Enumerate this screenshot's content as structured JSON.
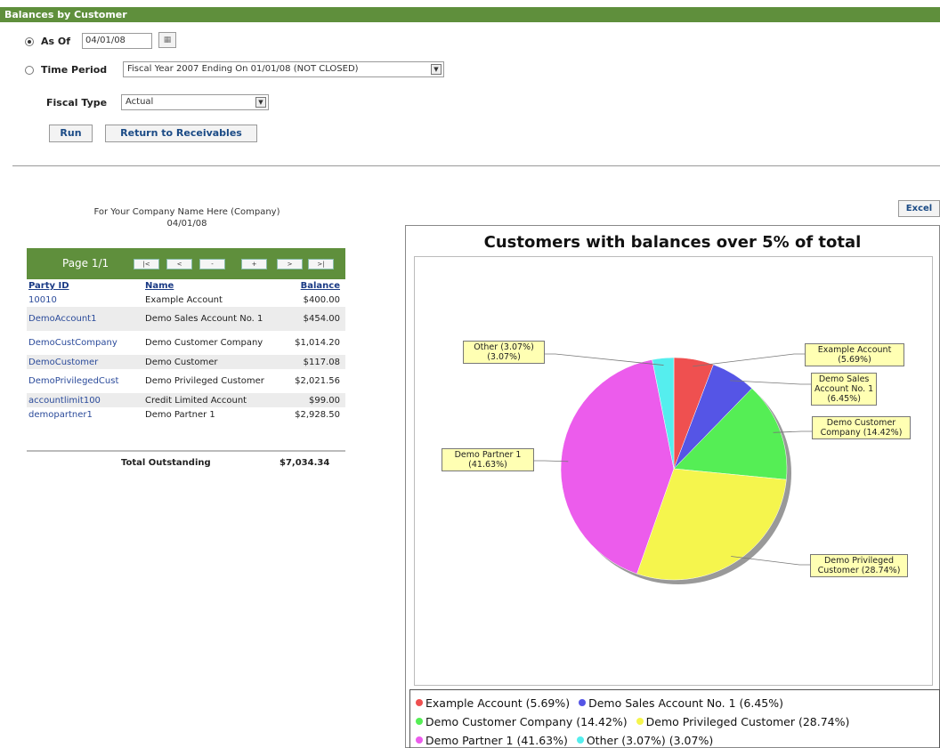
{
  "window": {
    "title": "Balances by Customer"
  },
  "form": {
    "as_of_label": "As Of",
    "as_of_value": "04/01/08",
    "time_period_label": "Time Period",
    "time_period_value": "Fiscal Year 2007 Ending On 01/01/08 (NOT CLOSED)",
    "fiscal_type_label": "Fiscal Type",
    "fiscal_type_value": "Actual",
    "run_label": "Run",
    "return_label": "Return to Receivables",
    "selected": "as_of"
  },
  "report": {
    "company": "For Your Company Name Here (Company)",
    "date": "04/01/08",
    "excel_label": "Excel"
  },
  "table": {
    "page_label": "Page 1/1",
    "pager_buttons": [
      "|<",
      "<",
      "-",
      "+",
      ">",
      ">|"
    ],
    "headers": {
      "party_id": "Party ID",
      "name": "Name",
      "balance": "Balance"
    },
    "rows": [
      {
        "party_id": "10010",
        "name": "Example Account",
        "balance": "$400.00"
      },
      {
        "party_id": "DemoAccount1",
        "name": "Demo Sales Account No. 1",
        "balance": "$454.00"
      },
      {
        "party_id": "DemoCustCompany",
        "name": "Demo Customer Company",
        "balance": "$1,014.20"
      },
      {
        "party_id": "DemoCustomer",
        "name": "Demo Customer",
        "balance": "$117.08"
      },
      {
        "party_id": "DemoPrivilegedCust",
        "name": "Demo Privileged Customer",
        "balance": "$2,021.56"
      },
      {
        "party_id": "accountlimit100",
        "name": "Credit Limited Account",
        "balance": "$99.00"
      },
      {
        "party_id": "demopartner1",
        "name": "Demo Partner 1",
        "balance": "$2,928.50"
      }
    ],
    "total_label": "Total Outstanding",
    "total_value": "$7,034.34"
  },
  "chart_data": {
    "type": "pie",
    "title": "Customers with balances over 5% of total",
    "slices": [
      {
        "label": "Example Account",
        "value": 5.69,
        "color": "#ef5050",
        "legend": "Example Account (5.69%)",
        "callout": [
          "Example Account",
          "(5.69%)"
        ]
      },
      {
        "label": "Demo Sales Account No. 1",
        "value": 6.45,
        "color": "#5555e6",
        "legend": "Demo Sales Account No. 1 (6.45%)",
        "callout": [
          "Demo Sales",
          "Account No. 1",
          "(6.45%)"
        ]
      },
      {
        "label": "Demo Customer Company",
        "value": 14.42,
        "color": "#55ee55",
        "legend": "Demo Customer Company (14.42%)",
        "callout": [
          "Demo Customer",
          "Company (14.42%)"
        ]
      },
      {
        "label": "Demo Privileged Customer",
        "value": 28.74,
        "color": "#f5f54d",
        "legend": "Demo Privileged Customer (28.74%)",
        "callout": [
          "Demo Privileged",
          "Customer (28.74%)"
        ]
      },
      {
        "label": "Demo Partner 1",
        "value": 41.63,
        "color": "#ec5cec",
        "legend": "Demo Partner 1 (41.63%)",
        "callout": [
          "Demo Partner 1",
          "(41.63%)"
        ]
      },
      {
        "label": "Other (3.07%)",
        "value": 3.07,
        "color": "#55eeee",
        "legend": "Other (3.07%) (3.07%)",
        "callout": [
          "Other (3.07%)",
          "(3.07%)"
        ]
      }
    ]
  }
}
